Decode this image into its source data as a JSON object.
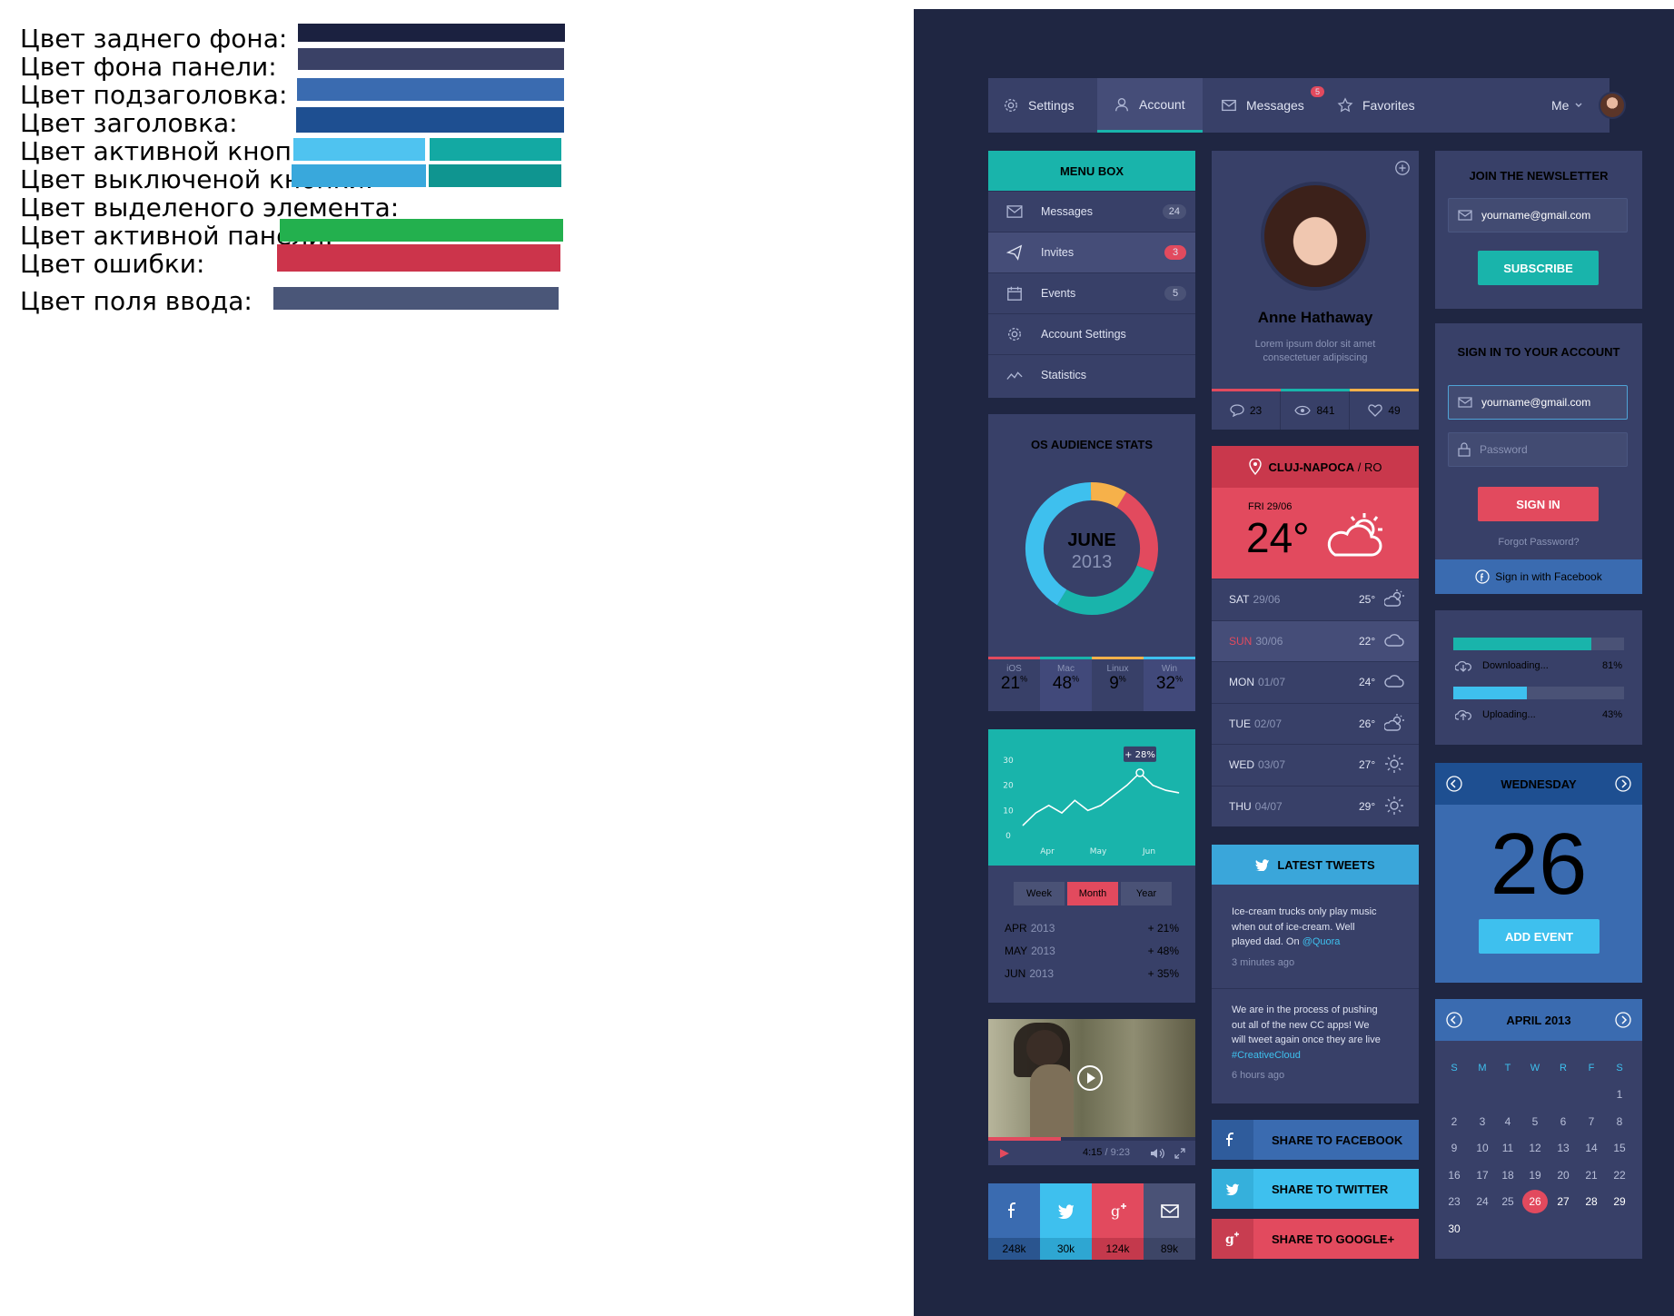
{
  "legend": {
    "rows": [
      {
        "label": "Цвет заднего фона:",
        "colors": [
          "#1b2140"
        ]
      },
      {
        "label": "Цвет фона панели:",
        "colors": [
          "#3a4166"
        ]
      },
      {
        "label": "Цвет подзаголовка:",
        "colors": [
          "#3a6bb0"
        ]
      },
      {
        "label": "Цвет заголовка:",
        "colors": [
          "#1e4f91"
        ]
      },
      {
        "label": "Цвет активной кнопки:",
        "colors": [
          "#4fc3f0",
          "#13a9a3"
        ]
      },
      {
        "label": "Цвет выключеной кнопки:",
        "colors": [
          "#39a8dc",
          "#0f9590"
        ]
      },
      {
        "label": "Цвет выделеного элемента:",
        "colors": []
      },
      {
        "label": "Цвет активной панели:",
        "colors": [
          "#23b04e"
        ]
      },
      {
        "label": "Цвет ошибки:",
        "colors": [
          "#cc344b"
        ]
      },
      {
        "label": "Цвет поля ввода:",
        "colors": [
          "#4a5678"
        ]
      }
    ]
  },
  "nav": {
    "settings": "Settings",
    "account": "Account",
    "messages": "Messages",
    "messages_badge": "5",
    "favorites": "Favorites",
    "me": "Me"
  },
  "menu": {
    "title": "MENU BOX",
    "items": [
      {
        "label": "Messages",
        "badge": "24"
      },
      {
        "label": "Invites",
        "badge": "3"
      },
      {
        "label": "Events",
        "badge": "5"
      },
      {
        "label": "Account Settings",
        "badge": ""
      },
      {
        "label": "Statistics",
        "badge": ""
      }
    ]
  },
  "profile": {
    "name": "Anne Hathaway",
    "bio_line1": "Lorem ipsum dolor sit amet",
    "bio_line2": "consectetuer adipiscing",
    "comments": "23",
    "views": "841",
    "likes": "49"
  },
  "newsletter": {
    "title": "JOIN THE NEWSLETTER",
    "email": "yourname@gmail.com",
    "button": "SUBSCRIBE"
  },
  "signin": {
    "title": "SIGN IN TO YOUR ACCOUNT",
    "email": "yourname@gmail.com",
    "password_placeholder": "Password",
    "button": "SIGN IN",
    "forgot": "Forgot Password?",
    "facebook": "Sign in with Facebook"
  },
  "os_stats": {
    "title": "OS AUDIENCE STATS",
    "month": "JUNE",
    "year": "2013",
    "items": [
      {
        "name": "iOS",
        "value": "21",
        "unit": "%",
        "color": "#e24a5e"
      },
      {
        "name": "Mac",
        "value": "48",
        "unit": "%",
        "color": "#19b4ab"
      },
      {
        "name": "Linux",
        "value": "9",
        "unit": "%",
        "color": "#f6b14a"
      },
      {
        "name": "Win",
        "value": "32",
        "unit": "%",
        "color": "#3ec0ee"
      }
    ]
  },
  "weather": {
    "location": "CLUJ-NAPOCA",
    "country": "/ RO",
    "today_label": "FRI",
    "today_date": "29/06",
    "today_temp": "24°",
    "days": [
      {
        "day": "SAT",
        "date": "29/06",
        "temp": "25°",
        "icon": "partly-cloudy-icon"
      },
      {
        "day": "SUN",
        "date": "30/06",
        "temp": "22°",
        "icon": "cloud-icon"
      },
      {
        "day": "MON",
        "date": "01/07",
        "temp": "24°",
        "icon": "cloud-icon"
      },
      {
        "day": "TUE",
        "date": "02/07",
        "temp": "26°",
        "icon": "partly-cloudy-icon"
      },
      {
        "day": "WED",
        "date": "03/07",
        "temp": "27°",
        "icon": "sun-icon"
      },
      {
        "day": "THU",
        "date": "04/07",
        "temp": "29°",
        "icon": "sun-icon"
      }
    ]
  },
  "progress": {
    "items": [
      {
        "label": "Downloading...",
        "value": "81%",
        "fraction": 0.81,
        "color": "#19b4ab"
      },
      {
        "label": "Uploading...",
        "value": "43%",
        "fraction": 0.43,
        "color": "#3ec0ee"
      }
    ]
  },
  "day_widget": {
    "weekday": "WEDNESDAY",
    "day": "26",
    "button": "ADD EVENT"
  },
  "chart_data": {
    "type": "line",
    "title": "",
    "xlabel": "",
    "ylabel": "",
    "y_ticks": [
      "30",
      "20",
      "10",
      "0"
    ],
    "x_ticks": [
      "Apr",
      "May",
      "Jun"
    ],
    "ylim": [
      0,
      30
    ],
    "x": [
      0,
      1,
      2,
      3,
      4,
      5,
      6,
      7,
      8,
      9,
      10,
      11,
      12
    ],
    "values": [
      4,
      9,
      12,
      9,
      14,
      10,
      12,
      16,
      20,
      25,
      20,
      18,
      17
    ],
    "tooltip": "+ 28%",
    "tabs": [
      "Week",
      "Month",
      "Year"
    ],
    "active_tab": "Month",
    "rows": [
      {
        "month": "APR",
        "year": "2013",
        "change": "+ 21%"
      },
      {
        "month": "MAY",
        "year": "2013",
        "change": "+ 48%"
      },
      {
        "month": "JUN",
        "year": "2013",
        "change": "+ 35%"
      }
    ]
  },
  "tweets": {
    "title": "LATEST TWEETS",
    "items": [
      {
        "l1": "Ice-cream trucks only play music",
        "l2": "when out of ice-cream. Well",
        "l3": "played dad. On",
        "link": "@Quora",
        "time": "3 minutes ago"
      },
      {
        "l1": "We are in the process of pushing",
        "l2": "out all of the new CC apps! We",
        "l3": "will tweet again once they are live",
        "link": "#CreativeCloud",
        "time": "6 hours ago"
      }
    ]
  },
  "video": {
    "time": "4:15",
    "duration": "/ 9:23",
    "progress": 0.35
  },
  "social": [
    {
      "icon": "facebook-icon",
      "count": "248k",
      "color": "#3a6bb0",
      "dark": "#2a558f"
    },
    {
      "icon": "twitter-icon",
      "count": "30k",
      "color": "#3ec0ee",
      "dark": "#2ea6d2"
    },
    {
      "icon": "google-plus-icon",
      "count": "124k",
      "color": "#e24a5e",
      "dark": "#c4394c"
    },
    {
      "icon": "mail-icon",
      "count": "89k",
      "color": "#4a5276",
      "dark": "#3d4566"
    }
  ],
  "share": [
    {
      "label": "SHARE TO FACEBOOK",
      "color": "#3a6bb0",
      "dark": "#2f5c9c"
    },
    {
      "label": "SHARE TO TWITTER",
      "color": "#3ec0ee",
      "dark": "#35b0dc"
    },
    {
      "label": "SHARE TO GOOGLE+",
      "color": "#e24a5e",
      "dark": "#c83d50"
    }
  ],
  "calendar": {
    "title": "APRIL 2013",
    "weekdays": [
      "S",
      "M",
      "T",
      "W",
      "R",
      "F",
      "S"
    ],
    "days": [
      "",
      "",
      "",
      "",
      "",
      "",
      "1",
      "2",
      "3",
      "4",
      "5",
      "6",
      "7",
      "8",
      "9",
      "10",
      "11",
      "12",
      "13",
      "14",
      "15",
      "16",
      "17",
      "18",
      "19",
      "20",
      "21",
      "22",
      "23",
      "24",
      "25",
      "26",
      "27",
      "28",
      "29",
      "30"
    ],
    "today": "26"
  }
}
